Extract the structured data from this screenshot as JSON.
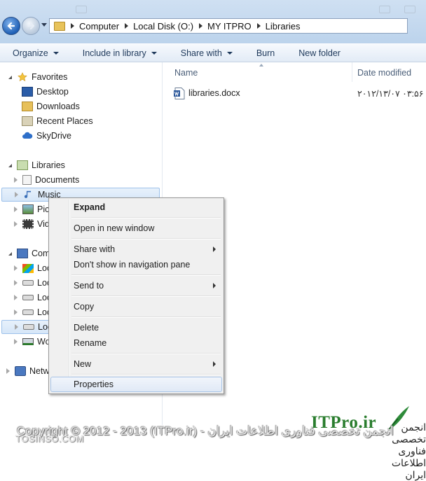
{
  "address": {
    "crumbs": [
      "Computer",
      "Local Disk (O:)",
      "MY ITPRO",
      "Libraries"
    ]
  },
  "toolbar": {
    "organize": "Organize",
    "include": "Include in library",
    "share": "Share with",
    "burn": "Burn",
    "new_folder": "New folder"
  },
  "nav": {
    "favorites": "Favorites",
    "desktop": "Desktop",
    "downloads": "Downloads",
    "recent": "Recent Places",
    "skydrive": "SkyDrive",
    "libraries": "Libraries",
    "documents": "Documents",
    "music": "Music",
    "pictures": "Pict",
    "videos": "Vid",
    "computer": "Comp",
    "loc1": "Loc",
    "loc2": "Loc",
    "loc3": "Loc",
    "loc4": "Loc",
    "loc5": "Loc",
    "wo": "Wo",
    "network": "Netw"
  },
  "columns": {
    "name": "Name",
    "date": "Date modified"
  },
  "files": [
    {
      "name": "libraries.docx",
      "date": "۲۰۱۲/۱۳/۰۷ ۰۳:۵۶ .."
    }
  ],
  "context_menu": {
    "expand": "Expand",
    "open_new": "Open in new window",
    "share_with": "Share with",
    "dont_show": "Don't show in navigation pane",
    "send_to": "Send to",
    "copy": "Copy",
    "delete": "Delete",
    "rename": "Rename",
    "new": "New",
    "properties": "Properties"
  },
  "watermark": {
    "brand": "ITPro.ir",
    "persian": "انجمن تخصصی فناوری اطلاعات ایران",
    "copyright": "Copyright © 2012 - 2013 (ITPro.ir) - انجمن تخصصی فناوری اطلاعات ایران",
    "site": "TOSINSO.COM"
  },
  "colors": {
    "accent": "#1e395b",
    "selection": "#d6e6f8",
    "brand_green": "#2a7d2e"
  }
}
